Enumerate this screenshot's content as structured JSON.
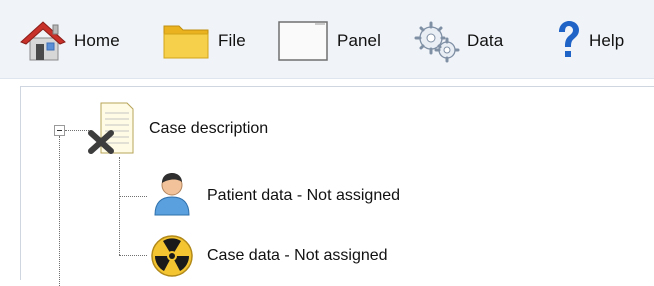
{
  "toolbar": {
    "items": [
      {
        "label": "Home",
        "icon": "home-icon"
      },
      {
        "label": "File",
        "icon": "folder-icon"
      },
      {
        "label": "Panel",
        "icon": "panel-icon"
      },
      {
        "label": "Data",
        "icon": "gears-icon"
      },
      {
        "label": "Help",
        "icon": "question-icon"
      }
    ]
  },
  "tree": {
    "root": {
      "label": "Case description",
      "icon": "document-x-icon",
      "expanded": true
    },
    "children": [
      {
        "label": "Patient data - Not assigned",
        "icon": "patient-icon"
      },
      {
        "label": "Case data - Not assigned",
        "icon": "radiation-icon"
      }
    ]
  },
  "colors": {
    "toolbar_bg": "#f0f3f8",
    "folder_yellow": "#f4c531",
    "help_blue": "#1f63c6",
    "home_red": "#c8302a"
  }
}
